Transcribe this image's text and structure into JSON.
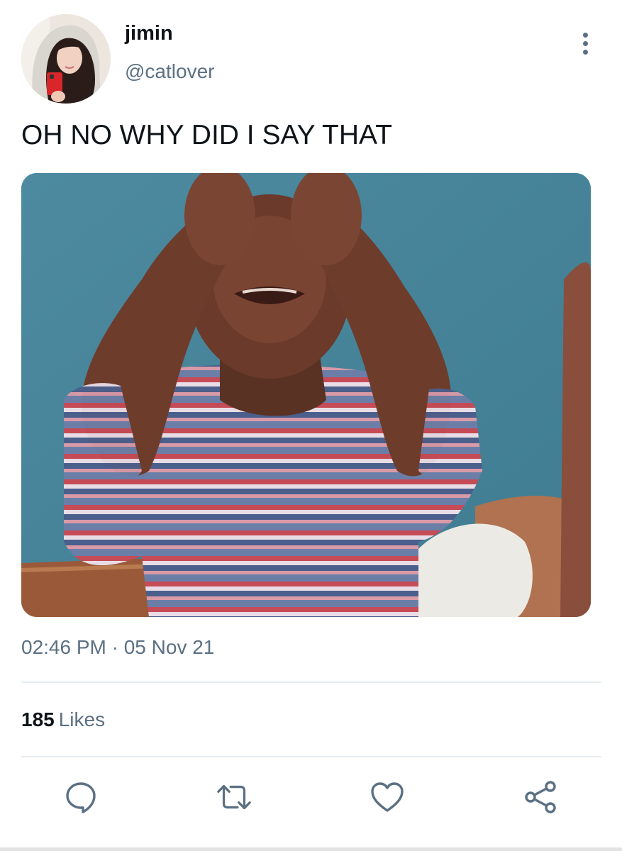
{
  "author": {
    "display_name": "jimin",
    "handle": "@catlover"
  },
  "tweet": {
    "text": "OH NO WHY DID I SAY THAT",
    "timestamp": "02:46 PM · 05 Nov 21"
  },
  "stats": {
    "likes_count": "185",
    "likes_label": "Likes"
  },
  "actions": {
    "reply_icon": "comment-icon",
    "retweet_icon": "retweet-icon",
    "like_icon": "heart-icon",
    "share_icon": "share-icon",
    "more_icon": "vertical-ellipsis-icon"
  },
  "colors": {
    "text_primary": "#0f1419",
    "text_secondary": "#5b7083",
    "divider": "#e6ecf0"
  }
}
